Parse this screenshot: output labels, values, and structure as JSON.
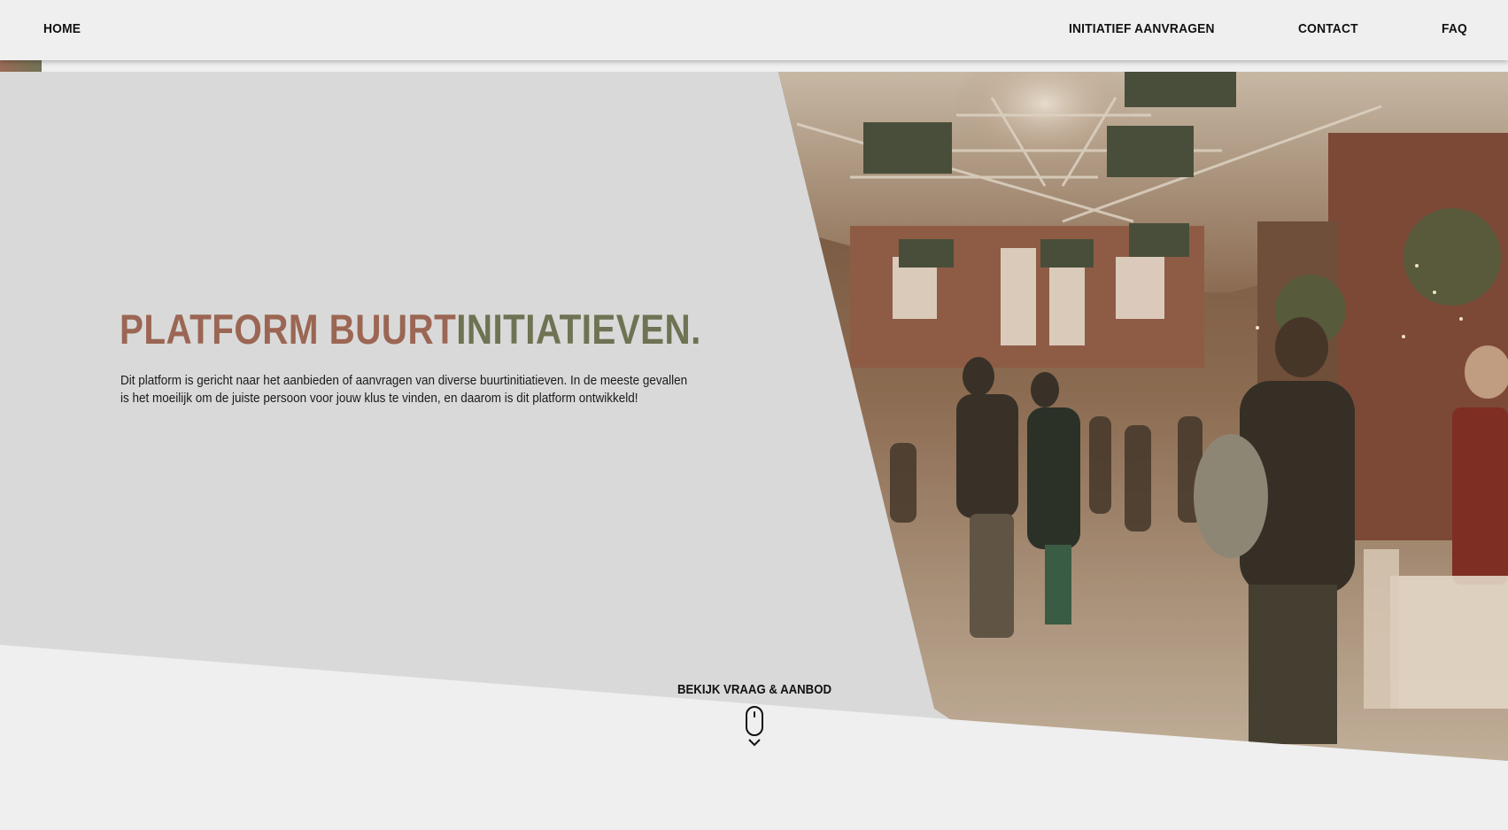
{
  "nav": {
    "home_label": "HOME",
    "initiatief_label": "INITIATIEF AANVRAGEN",
    "contact_label": "CONTACT",
    "faq_label": "FAQ"
  },
  "hero": {
    "title_part1": "PLATFORM BUURT",
    "title_part2": "INITIATIEVEN.",
    "description": "Dit platform is gericht naar het aanbieden of aanvragen van diverse buurtinitiatieven. In de meeste gevallen is het moeilijk om de juiste persoon voor jouw klus te vinden, en daarom is dit platform ontwikkeld!",
    "scroll_label": "BEKIJK VRAAG & AANBOD"
  },
  "colors": {
    "brand_terracotta": "#9b6653",
    "brand_olive": "#6f7253",
    "background": "#efefef",
    "hero_panel": "#d9d9d9"
  },
  "icons": {
    "mouse": "mouse-scroll-icon",
    "chevron": "chevron-down-icon"
  }
}
